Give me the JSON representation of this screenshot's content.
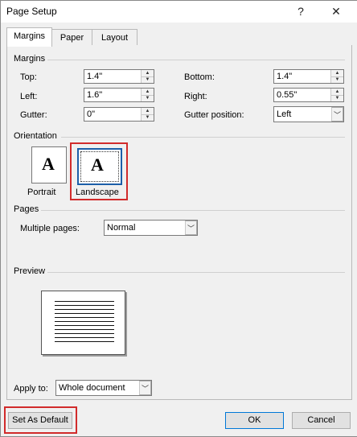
{
  "window": {
    "title": "Page Setup",
    "help_glyph": "?",
    "close_glyph": "✕"
  },
  "tabs": [
    {
      "label": "Margins",
      "active": true
    },
    {
      "label": "Paper",
      "active": false
    },
    {
      "label": "Layout",
      "active": false
    }
  ],
  "margins": {
    "group_label": "Margins",
    "top": {
      "label": "Top:",
      "value": "1.4\""
    },
    "bottom": {
      "label": "Bottom:",
      "value": "1.4\""
    },
    "left": {
      "label": "Left:",
      "value": "1.6\""
    },
    "right": {
      "label": "Right:",
      "value": "0.55\""
    },
    "gutter": {
      "label": "Gutter:",
      "value": "0\""
    },
    "gutter_position": {
      "label": "Gutter position:",
      "value": "Left"
    }
  },
  "orientation": {
    "group_label": "Orientation",
    "portrait_label": "Portrait",
    "landscape_label": "Landscape",
    "icon_letter": "A",
    "selected": "Landscape"
  },
  "pages": {
    "group_label": "Pages",
    "multiple_pages_label": "Multiple pages:",
    "multiple_pages_value": "Normal"
  },
  "preview": {
    "group_label": "Preview",
    "apply_to_label": "Apply to:",
    "apply_to_value": "Whole document"
  },
  "buttons": {
    "set_as_default": "Set As Default",
    "ok": "OK",
    "cancel": "Cancel"
  },
  "highlight_color": "#d12b2b",
  "icons": {
    "spin_up": "▲",
    "spin_down": "▼",
    "dropdown": "﹀"
  }
}
